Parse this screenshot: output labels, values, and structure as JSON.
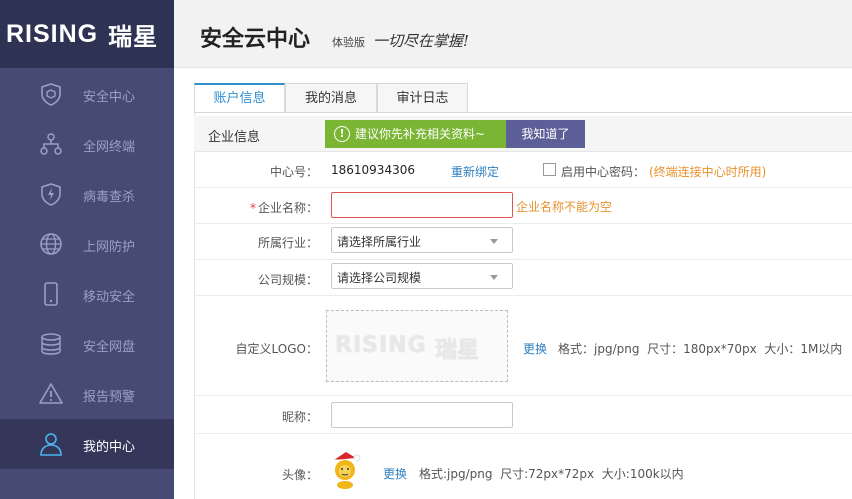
{
  "brand": {
    "logo_text": "RISING",
    "logo_cn": "瑞星"
  },
  "header": {
    "title": "安全云中心",
    "edition": "体验版",
    "slogan": "一切尽在掌握!"
  },
  "sidebar": {
    "items": [
      {
        "label": "安全中心",
        "icon": "shield-icon"
      },
      {
        "label": "全网终端",
        "icon": "network-icon"
      },
      {
        "label": "病毒查杀",
        "icon": "virus-scan-icon"
      },
      {
        "label": "上网防护",
        "icon": "globe-icon"
      },
      {
        "label": "移动安全",
        "icon": "mobile-icon"
      },
      {
        "label": "安全网盘",
        "icon": "database-icon"
      },
      {
        "label": "报告预警",
        "icon": "warning-icon"
      },
      {
        "label": "我的中心",
        "icon": "user-icon",
        "active": true
      }
    ]
  },
  "tabs": [
    {
      "label": "账户信息",
      "active": true
    },
    {
      "label": "我的消息"
    },
    {
      "label": "审计日志"
    }
  ],
  "section": {
    "label": "企业信息",
    "tip": "建议你先补充相关资料~",
    "ack_button": "我知道了"
  },
  "form": {
    "center_id": {
      "label": "中心号：",
      "value": "18610934306",
      "rebind": "重新绑定",
      "password_label": "启用中心密码：",
      "password_hint": "(终端连接中心时所用)"
    },
    "company_name": {
      "required": "*",
      "label": "企业名称：",
      "value": "",
      "error": "企业名称不能为空"
    },
    "industry": {
      "label": "所属行业：",
      "selected": "请选择所属行业"
    },
    "company_size": {
      "label": "公司规模：",
      "selected": "请选择公司规模"
    },
    "logo": {
      "label": "自定义LOGO：",
      "preview_text": "RISING",
      "preview_cn": "瑞星",
      "change": "更换",
      "spec": "格式：jpg/png  尺寸：180px*70px  大小：1M以内"
    },
    "nickname": {
      "label": "昵称：",
      "value": ""
    },
    "avatar": {
      "label": "头像：",
      "change": "更换",
      "spec": "格式:jpg/png  尺寸:72px*72px  大小:100k以内"
    }
  },
  "colors": {
    "sidebar_bg": "#474b73",
    "accent": "#2f8fd1",
    "tip_green": "#7ab533",
    "ack_purple": "#5d6098",
    "error": "#e25555"
  }
}
